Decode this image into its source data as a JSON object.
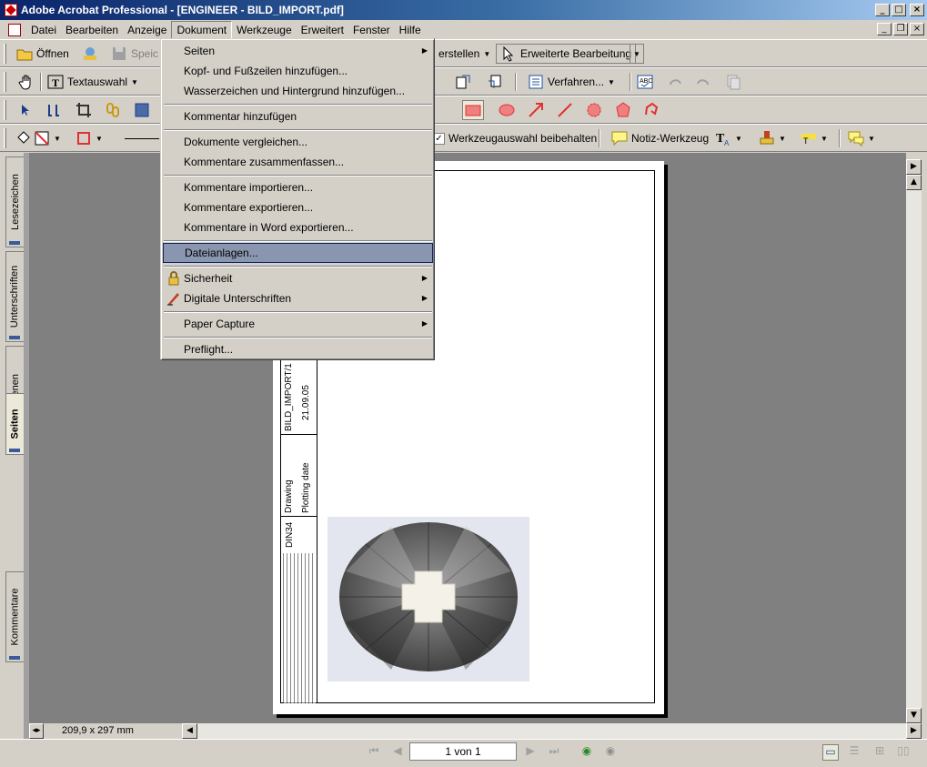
{
  "window": {
    "title": "Adobe Acrobat Professional - [ENGINEER - BILD_IMPORT.pdf]"
  },
  "menubar": [
    "Datei",
    "Bearbeiten",
    "Anzeige",
    "Dokument",
    "Werkzeuge",
    "Erweitert",
    "Fenster",
    "Hilfe"
  ],
  "toolbar1": {
    "open": "Öffnen",
    "save": "Speic",
    "create": "erstellen",
    "advanced_edit": "Erweiterte Bearbeitung"
  },
  "toolbar2": {
    "text_select": "Textauswahl",
    "procedures": "Verfahren..."
  },
  "toolbar4": {
    "keep_tool": "Werkzeugauswahl beibehalten",
    "note_tool": "Notiz-Werkzeug"
  },
  "dokument_menu": [
    {
      "label": "Seiten",
      "submenu": true
    },
    {
      "label": "Kopf- und Fußzeilen hinzufügen..."
    },
    {
      "label": "Wasserzeichen und Hintergrund hinzufügen..."
    },
    {
      "label": "Kommentar hinzufügen"
    },
    {
      "label": "Dokumente vergleichen..."
    },
    {
      "label": "Kommentare zusammenfassen..."
    },
    {
      "label": "Kommentare importieren..."
    },
    {
      "label": "Kommentare exportieren..."
    },
    {
      "label": "Kommentare in Word exportieren..."
    },
    {
      "label": "Dateianlagen...",
      "highlighted": true
    },
    {
      "label": "Sicherheit",
      "submenu": true,
      "icon": "lock-icon"
    },
    {
      "label": "Digitale Unterschriften",
      "submenu": true,
      "icon": "pen-icon"
    },
    {
      "label": "Paper Capture",
      "submenu": true
    },
    {
      "label": "Preflight..."
    }
  ],
  "side_tabs": [
    "Lesezeichen",
    "Unterschriften",
    "Ebenen",
    "Seiten",
    "Kommentare"
  ],
  "drawing": {
    "doc_name": "BILD_IMPORT/1",
    "date": "21.09.05",
    "drawing_label": "Drawing",
    "plotting_label": "Plotting date",
    "din": "DIN34"
  },
  "page_size": "209,9 x 297 mm",
  "page_indicator": "1 von 1",
  "colors": {
    "title_start": "#0a246a",
    "title_end": "#a6caf0",
    "menu_highlight": "#8a96b0",
    "annot_red": "#e03030"
  }
}
